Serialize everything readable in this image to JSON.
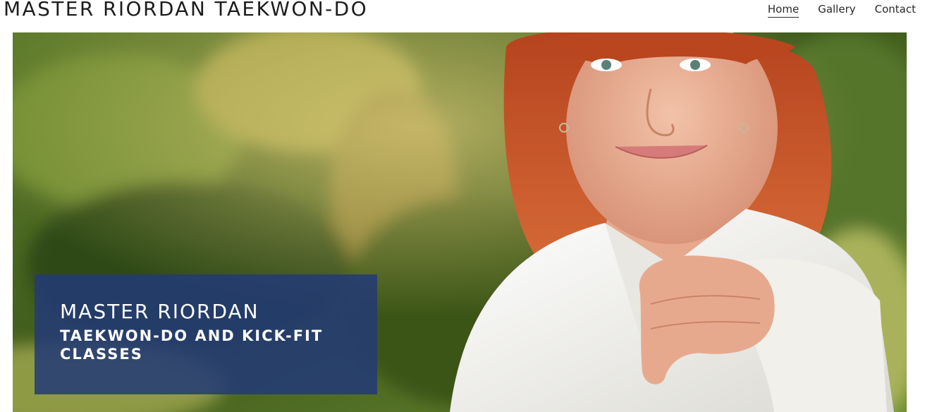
{
  "header": {
    "site_title": "MASTER RIORDAN TAEKWON-DO",
    "nav": [
      {
        "label": "Home",
        "active": true
      },
      {
        "label": "Gallery",
        "active": false
      },
      {
        "label": "Contact",
        "active": false
      }
    ]
  },
  "hero": {
    "caption_title": "MASTER RIORDAN",
    "caption_subtitle": "TAEKWON-DO AND KICK-FIT CLASSES",
    "caption_bg": "#233a76"
  },
  "colors": {
    "foliage": "#4a6a22",
    "hair": "#c2532b",
    "uniform": "#f4f4f2"
  }
}
